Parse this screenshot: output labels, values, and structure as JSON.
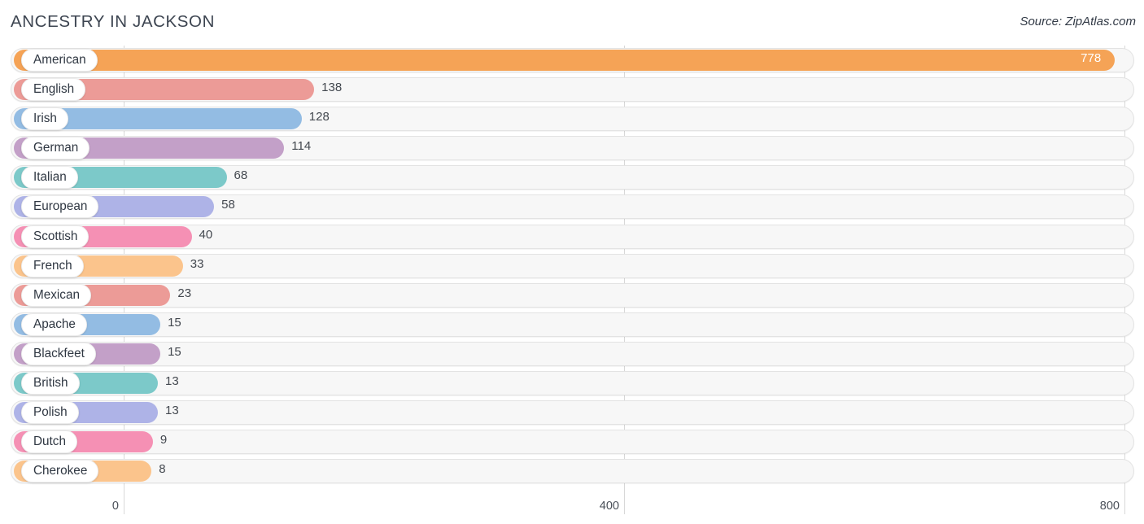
{
  "header": {
    "title": "ANCESTRY IN JACKSON",
    "source": "Source: ZipAtlas.com"
  },
  "chart_data": {
    "type": "bar",
    "orientation": "horizontal",
    "title": "ANCESTRY IN JACKSON",
    "xlabel": "",
    "ylabel": "",
    "xlim": [
      0,
      800
    ],
    "ticks": [
      "0",
      "400",
      "800"
    ],
    "tick_values": [
      0,
      400,
      800
    ],
    "grid": true,
    "legend": false,
    "categories": [
      "American",
      "English",
      "Irish",
      "German",
      "Italian",
      "European",
      "Scottish",
      "French",
      "Mexican",
      "Apache",
      "Blackfeet",
      "British",
      "Polish",
      "Dutch",
      "Cherokee"
    ],
    "values": [
      778,
      138,
      128,
      114,
      68,
      58,
      40,
      33,
      23,
      15,
      15,
      13,
      13,
      9,
      8
    ],
    "labels": [
      "778",
      "138",
      "128",
      "114",
      "68",
      "58",
      "40",
      "33",
      "23",
      "15",
      "15",
      "13",
      "13",
      "9",
      "8"
    ],
    "colors": [
      "#f5a356",
      "#ec9b97",
      "#93bce3",
      "#c3a0c8",
      "#7cc9c9",
      "#aeb3e7",
      "#f590b4",
      "#fbc48c",
      "#ec9b97",
      "#93bce3",
      "#c3a0c8",
      "#7cc9c9",
      "#aeb3e7",
      "#f590b4",
      "#fbc48c"
    ],
    "rows": [
      {
        "label": "American",
        "value": 778,
        "display": "778",
        "color": "#f5a356",
        "value_inside": true
      },
      {
        "label": "English",
        "value": 138,
        "display": "138",
        "color": "#ec9b97",
        "value_inside": false
      },
      {
        "label": "Irish",
        "value": 128,
        "display": "128",
        "color": "#93bce3",
        "value_inside": false
      },
      {
        "label": "German",
        "value": 114,
        "display": "114",
        "color": "#c3a0c8",
        "value_inside": false
      },
      {
        "label": "Italian",
        "value": 68,
        "display": "68",
        "color": "#7cc9c9",
        "value_inside": false
      },
      {
        "label": "European",
        "value": 58,
        "display": "58",
        "color": "#aeb3e7",
        "value_inside": false
      },
      {
        "label": "Scottish",
        "value": 40,
        "display": "40",
        "color": "#f590b4",
        "value_inside": false
      },
      {
        "label": "French",
        "value": 33,
        "display": "33",
        "color": "#fbc48c",
        "value_inside": false
      },
      {
        "label": "Mexican",
        "value": 23,
        "display": "23",
        "color": "#ec9b97",
        "value_inside": false
      },
      {
        "label": "Apache",
        "value": 15,
        "display": "15",
        "color": "#93bce3",
        "value_inside": false
      },
      {
        "label": "Blackfeet",
        "value": 15,
        "display": "15",
        "color": "#c3a0c8",
        "value_inside": false
      },
      {
        "label": "British",
        "value": 13,
        "display": "13",
        "color": "#7cc9c9",
        "value_inside": false
      },
      {
        "label": "Polish",
        "value": 13,
        "display": "13",
        "color": "#aeb3e7",
        "value_inside": false
      },
      {
        "label": "Dutch",
        "value": 9,
        "display": "9",
        "color": "#f590b4",
        "value_inside": false
      },
      {
        "label": "Cherokee",
        "value": 8,
        "display": "8",
        "color": "#fbc48c",
        "value_inside": false
      }
    ]
  }
}
